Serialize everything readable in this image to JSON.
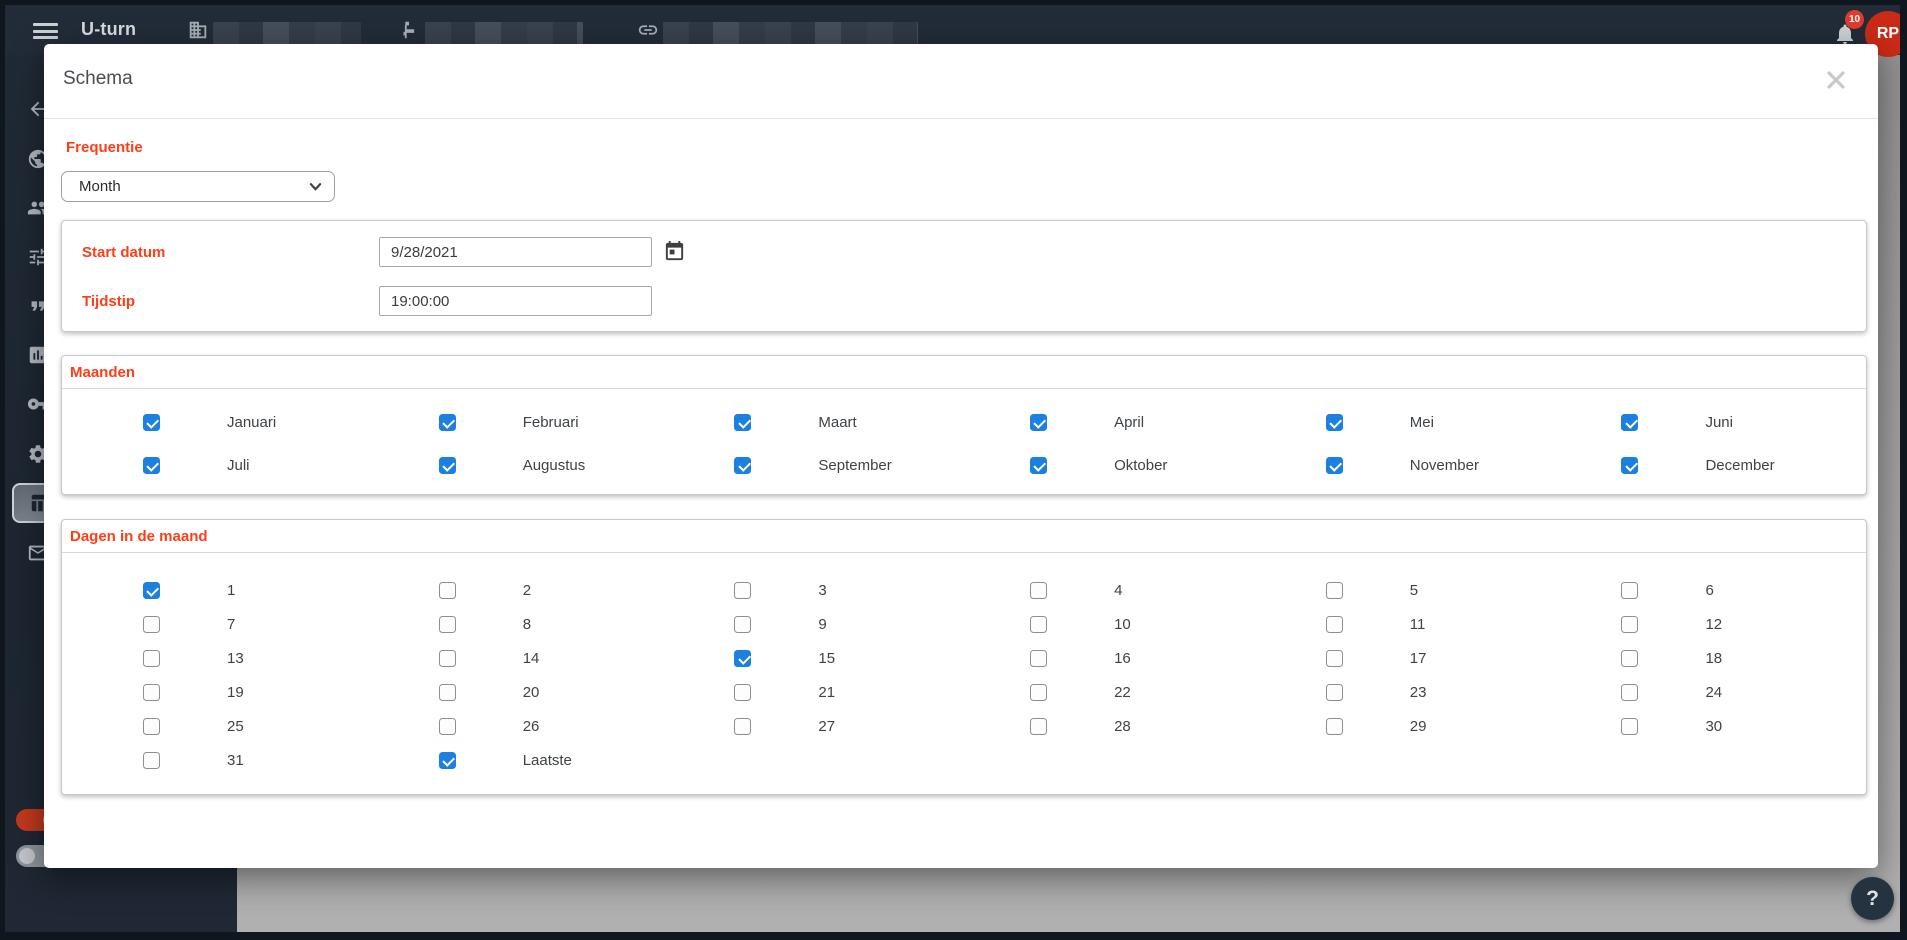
{
  "topbar": {
    "app_title": "U-turn",
    "notification_count": "10",
    "avatar_initials": "RP",
    "nav_items": [
      {
        "icon": "building-icon",
        "redacted": true
      },
      {
        "icon": "satellite-icon",
        "redacted": true
      },
      {
        "icon": "link-icon",
        "redacted": true
      }
    ]
  },
  "sidebar": {
    "icons": [
      "back-arrow-icon",
      "globe-icon",
      "users-icon",
      "sliders-icon",
      "quote-icon",
      "bar-chart-icon",
      "key-icon",
      "gear-icon",
      "table-icon",
      "mail-icon"
    ],
    "selected": "table-icon",
    "toggles": [
      {
        "name": "toggle-on",
        "state": "on"
      },
      {
        "name": "toggle-off",
        "state": "off"
      }
    ]
  },
  "modal": {
    "title": "Schema",
    "frequency": {
      "label": "Frequentie",
      "value": "Month"
    },
    "start_date": {
      "label": "Start datum",
      "value": "9/28/2021"
    },
    "time": {
      "label": "Tijdstip",
      "value": "19:00:00"
    },
    "months": {
      "label": "Maanden",
      "items": [
        {
          "label": "Januari",
          "checked": true
        },
        {
          "label": "Februari",
          "checked": true
        },
        {
          "label": "Maart",
          "checked": true
        },
        {
          "label": "April",
          "checked": true
        },
        {
          "label": "Mei",
          "checked": true
        },
        {
          "label": "Juni",
          "checked": true
        },
        {
          "label": "Juli",
          "checked": true
        },
        {
          "label": "Augustus",
          "checked": true
        },
        {
          "label": "September",
          "checked": true
        },
        {
          "label": "Oktober",
          "checked": true
        },
        {
          "label": "November",
          "checked": true
        },
        {
          "label": "December",
          "checked": true
        }
      ]
    },
    "days": {
      "label": "Dagen in de maand",
      "items": [
        {
          "label": "1",
          "checked": true
        },
        {
          "label": "2",
          "checked": false
        },
        {
          "label": "3",
          "checked": false
        },
        {
          "label": "4",
          "checked": false
        },
        {
          "label": "5",
          "checked": false
        },
        {
          "label": "6",
          "checked": false
        },
        {
          "label": "7",
          "checked": false
        },
        {
          "label": "8",
          "checked": false
        },
        {
          "label": "9",
          "checked": false
        },
        {
          "label": "10",
          "checked": false
        },
        {
          "label": "11",
          "checked": false
        },
        {
          "label": "12",
          "checked": false
        },
        {
          "label": "13",
          "checked": false
        },
        {
          "label": "14",
          "checked": false
        },
        {
          "label": "15",
          "checked": true
        },
        {
          "label": "16",
          "checked": false
        },
        {
          "label": "17",
          "checked": false
        },
        {
          "label": "18",
          "checked": false
        },
        {
          "label": "19",
          "checked": false
        },
        {
          "label": "20",
          "checked": false
        },
        {
          "label": "21",
          "checked": false
        },
        {
          "label": "22",
          "checked": false
        },
        {
          "label": "23",
          "checked": false
        },
        {
          "label": "24",
          "checked": false
        },
        {
          "label": "25",
          "checked": false
        },
        {
          "label": "26",
          "checked": false
        },
        {
          "label": "27",
          "checked": false
        },
        {
          "label": "28",
          "checked": false
        },
        {
          "label": "29",
          "checked": false
        },
        {
          "label": "30",
          "checked": false
        },
        {
          "label": "31",
          "checked": false
        },
        {
          "label": "Laatste",
          "checked": true
        }
      ]
    }
  },
  "help_button": {
    "label": "?"
  },
  "colors": {
    "accent_red": "#ff3d17",
    "checkbox_blue": "#1b80e0",
    "topbar_bg": "#222c39",
    "drawer_bg": "#1e2732",
    "avatar_red": "#cb2b16",
    "badge_red": "#e23b2e",
    "help_fab_bg": "#25323f",
    "toggle_on_red": "#c2391b"
  }
}
